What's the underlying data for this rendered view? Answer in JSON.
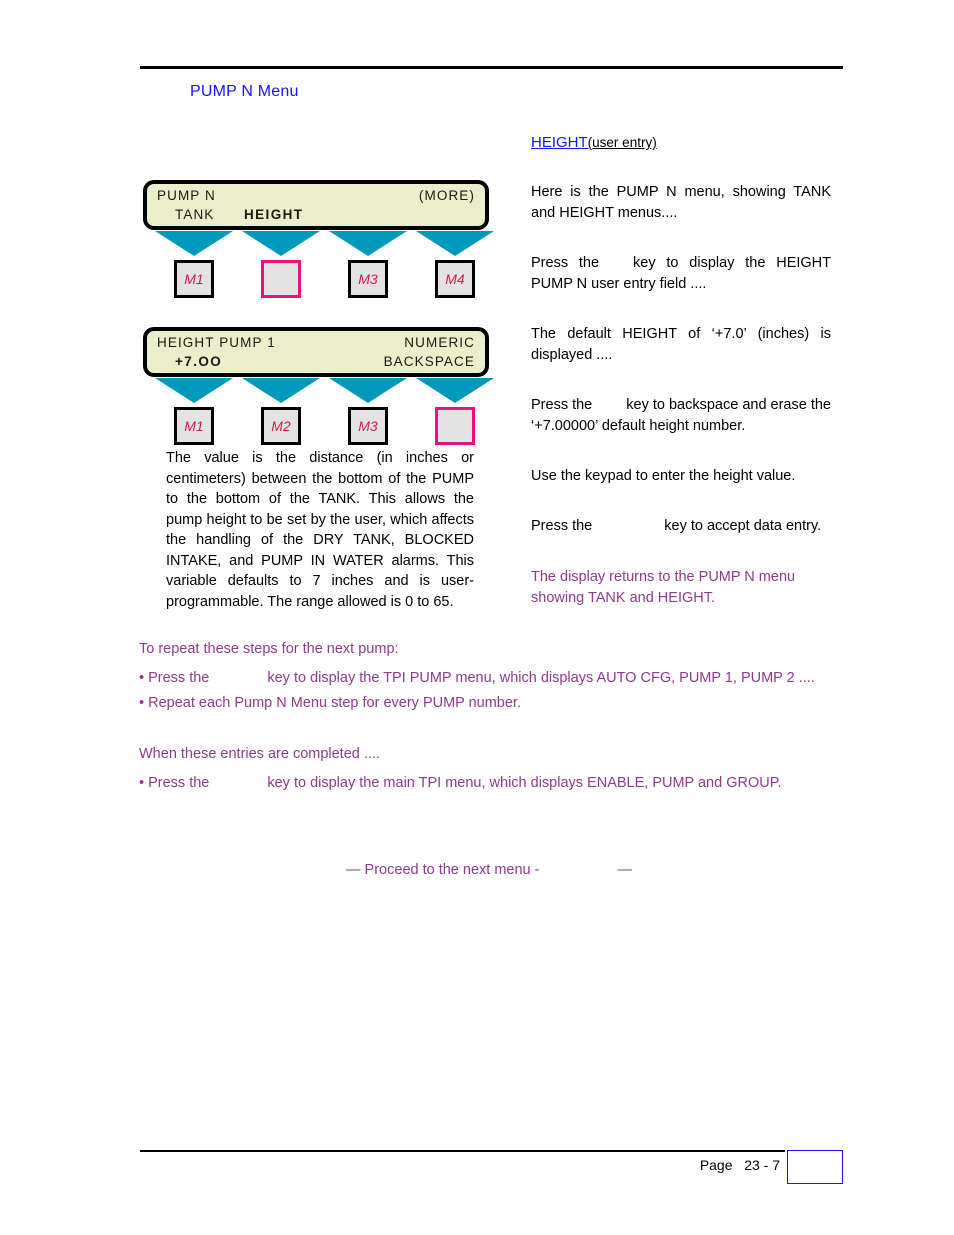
{
  "page_title": "PUMP N Menu",
  "section": {
    "heading_link": "HEIGHT",
    "heading_note": "(user entry)"
  },
  "lcd_panels": [
    {
      "name": "pump-n-menu-display",
      "line1_left": "PUMP N",
      "line1_right": "(MORE)",
      "line2_left": "TANK",
      "line2_mid": "HEIGHT",
      "line2_right": "",
      "softkeys": [
        {
          "label": "M1",
          "selected": false
        },
        {
          "label": "",
          "selected": true
        },
        {
          "label": "M3",
          "selected": false
        },
        {
          "label": "M4",
          "selected": false
        }
      ]
    },
    {
      "name": "height-pump-1-entry-display",
      "line1_left": "HEIGHT PUMP 1",
      "line1_right": "NUMERIC",
      "line2_left": "+7.OO",
      "line2_mid": "",
      "line2_right": "BACKSPACE",
      "softkeys": [
        {
          "label": "M1",
          "selected": false
        },
        {
          "label": "M2",
          "selected": false
        },
        {
          "label": "M3",
          "selected": false
        },
        {
          "label": "",
          "selected": true
        }
      ]
    }
  ],
  "left_paragraph": "The value is the distance (in inches or centimeters) between the bottom of the PUMP to the bottom of the TANK. This allows the pump height to be set by the user, which affects the handling of the DRY TANK, BLOCKED INTAKE, and PUMP IN WATER alarms. This variable defaults to 7 inches and is user-programmable. The range allowed is 0 to 65.",
  "right_column": {
    "p1": "Here is the PUMP N menu, showing TANK and HEIGHT menus....",
    "p2_a": "Press the",
    "p2_b": "key to display the  HEIGHT PUMP N user entry field ....",
    "p3": "The  default HEIGHT of ‘+7.0’ (inches) is displayed  ....",
    "p4_a": "Press the",
    "p4_b": "key to backspace and erase the ‘+7.00000’ default height number.",
    "p5": "Use the keypad to enter the height value.",
    "p6_a": "Press the",
    "p6_b": "key to accept data entry.",
    "p7": "The display returns to the PUMP N menu showing TANK and HEIGHT."
  },
  "bottom_block": {
    "lead1": "To repeat these steps for the next pump:",
    "bullet1_a": "• Press the",
    "bullet1_b": "key to display the TPI PUMP menu, which displays AUTO CFG, PUMP 1, PUMP 2 ....",
    "bullet2": "• Repeat each Pump N Menu step for every PUMP number.",
    "lead2": "When these entries are completed ....",
    "bullet3_a": "•  Press the",
    "bullet3_b": "key to display the main TPI menu, which displays ENABLE, PUMP and GROUP."
  },
  "proceed": {
    "text_a": "— Proceed to the next menu -",
    "text_b": "—"
  },
  "footer": {
    "page_label": "Page",
    "page_number": "23 - 7"
  },
  "colors": {
    "title_blue": "#1414ff",
    "purple": "#8e3a8e",
    "lcd_bg": "#eaeecb",
    "arrow_cyan": "#0099bb",
    "key_label_red": "#d61a4a",
    "selected_pink": "#ec0f7c"
  }
}
